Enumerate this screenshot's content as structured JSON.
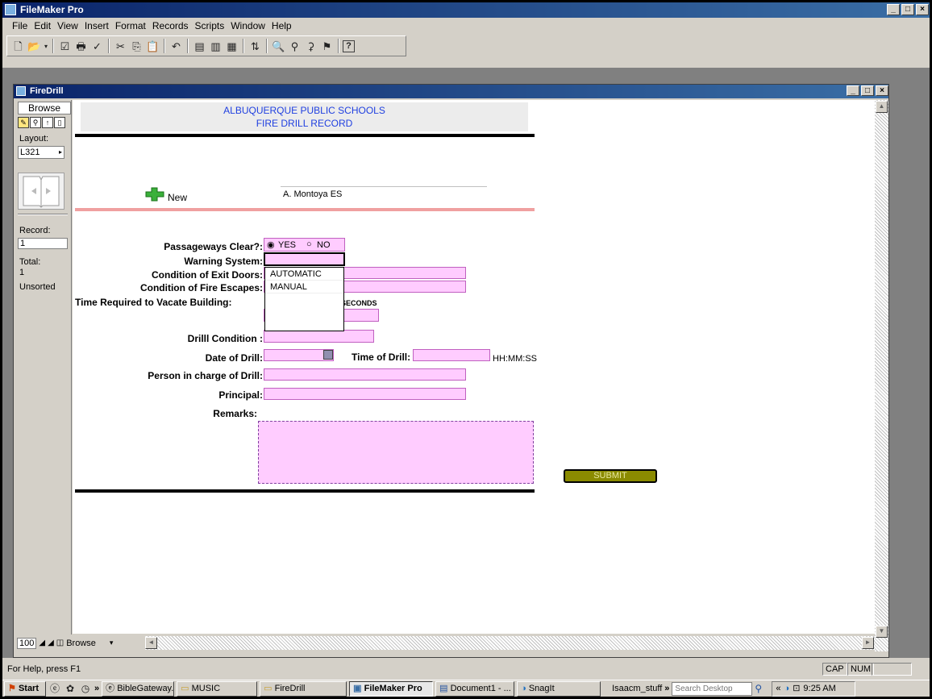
{
  "app": {
    "title": "FileMaker Pro"
  },
  "menu": [
    "File",
    "Edit",
    "View",
    "Insert",
    "Format",
    "Records",
    "Scripts",
    "Window",
    "Help"
  ],
  "doc": {
    "title": "FireDrill"
  },
  "status": {
    "mode": "Browse",
    "layout_label": "Layout:",
    "layout_value": "L321",
    "record_label": "Record:",
    "record_value": "1",
    "total_label": "Total:",
    "total_value": "1",
    "sort_state": "Unsorted",
    "zoom": "100",
    "mode_bottom": "Browse"
  },
  "form": {
    "header_line1": "ALBUQUERQUE PUBLIC SCHOOLS",
    "header_line2": "FIRE DRILL RECORD",
    "new_label": "New",
    "school": "A. Montoya ES",
    "passageways_label": "Passageways Clear?:",
    "yes_label": "YES",
    "no_label": "NO",
    "warning_label": "Warning System:",
    "exit_doors_label": "Condition of Exit Doors:",
    "fire_escapes_label": "Condition of  Fire Escapes:",
    "vacate_label": "Time Required to Vacate Building:",
    "seconds_label": "SECONDS",
    "drill_condition_label": "Drilll Condition :",
    "date_label": "Date of Drill:",
    "time_label": "Time of Drill:",
    "time_format": "HH:MM:SS",
    "person_label": "Person in charge of Drill:",
    "principal_label": "Principal:",
    "remarks_label": "Remarks:",
    "submit_label": "SUBMIT",
    "warning_options": [
      "AUTOMATIC",
      "MANUAL"
    ]
  },
  "statusbar": {
    "help": "For Help, press F1",
    "cap": "CAP",
    "num": "NUM"
  },
  "taskbar": {
    "start": "Start",
    "items": [
      "BibleGateway...",
      "MUSIC",
      "FireDrill",
      "FileMaker Pro",
      "Document1 - ...",
      "SnagIt"
    ],
    "user": "Isaacm_stuff",
    "search_placeholder": "Search Desktop",
    "clock": "9:25 AM"
  },
  "colors": {
    "field_fill": "#ffccff",
    "header_text": "#2040e0",
    "submit_fill": "#8b8b00",
    "titlebar": "#0a246a"
  }
}
